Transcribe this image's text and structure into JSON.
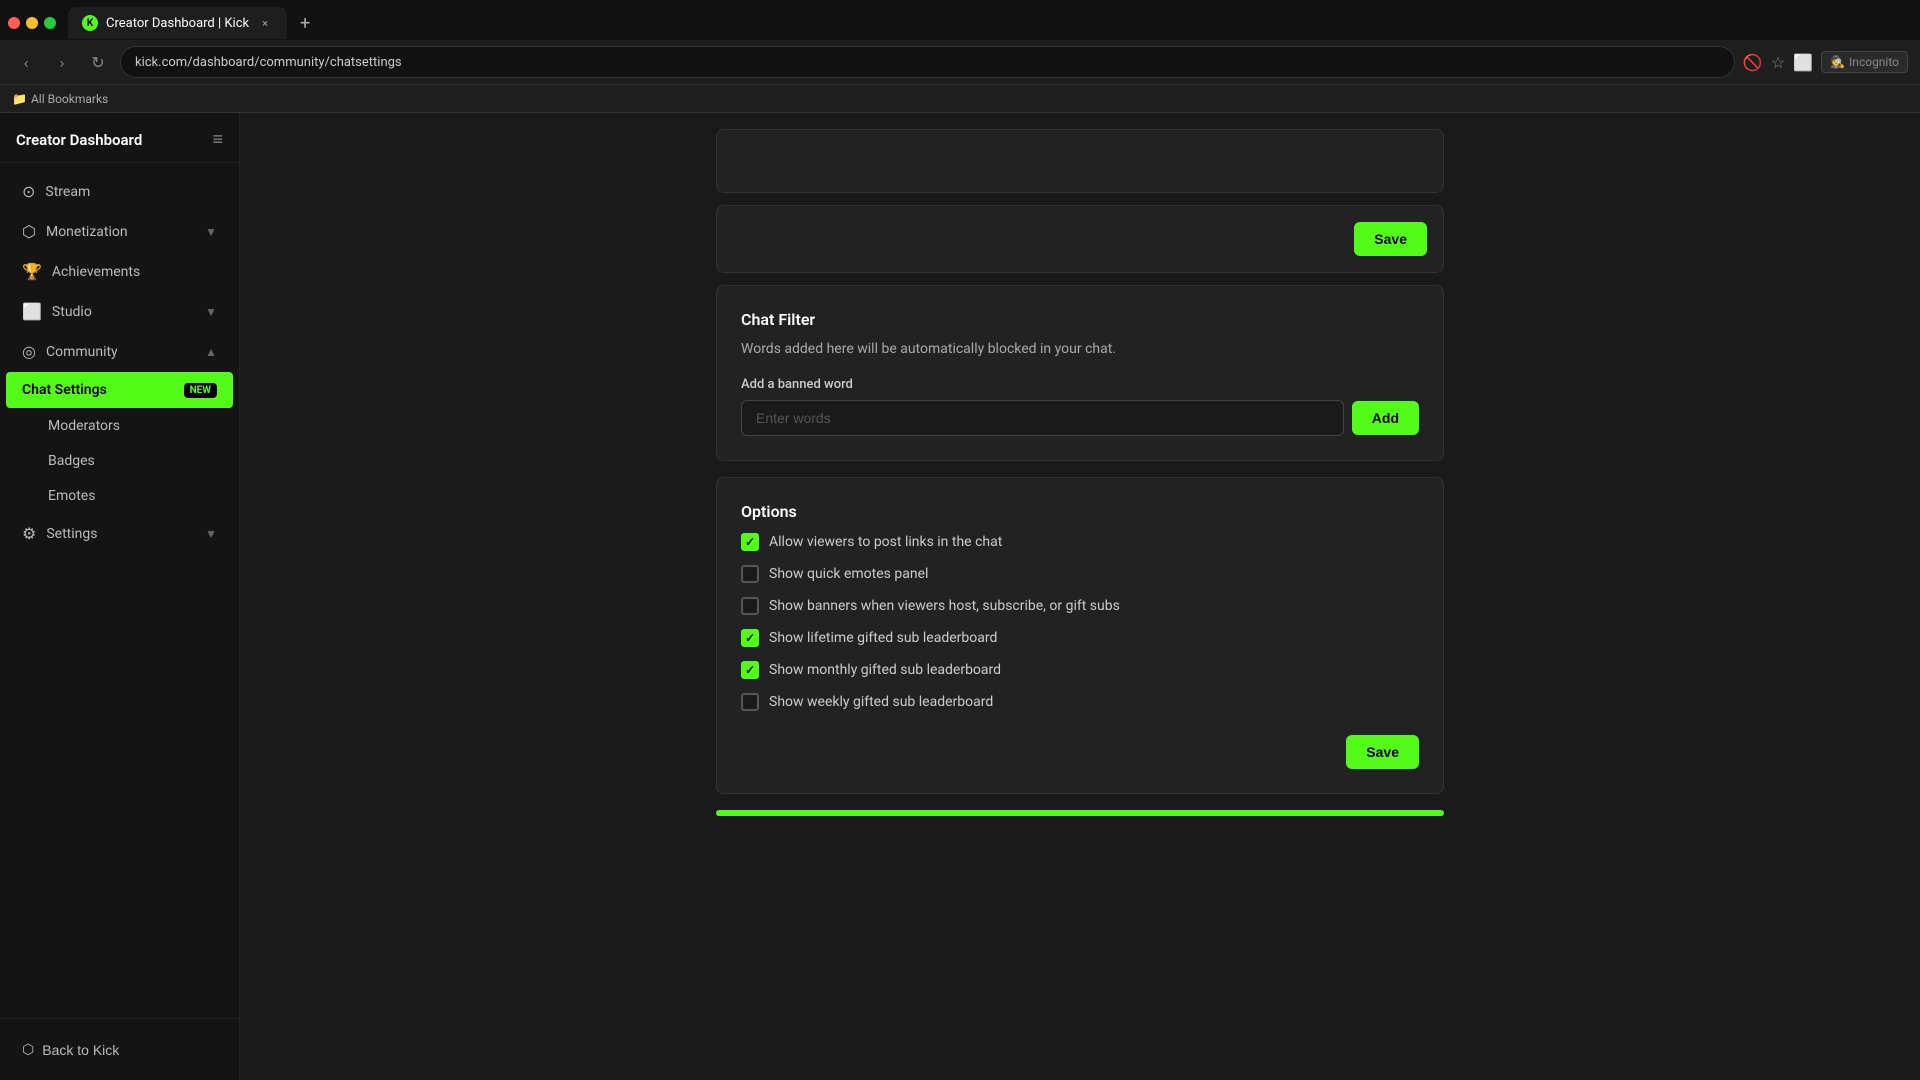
{
  "browser": {
    "tab_title": "Creator Dashboard | Kick",
    "tab_favicon": "K",
    "url": "kick.com/dashboard/community/chatsettings",
    "new_tab_label": "+",
    "close_label": "×",
    "back_label": "‹",
    "forward_label": "›",
    "refresh_label": "↻",
    "incognito_label": "Incognito",
    "bookmarks_label": "All Bookmarks"
  },
  "sidebar": {
    "title": "Creator Dashboard",
    "collapse_icon": "≡",
    "nav_items": [
      {
        "id": "stream",
        "label": "Stream",
        "icon": "⊙",
        "has_arrow": false
      },
      {
        "id": "monetization",
        "label": "Monetization",
        "icon": "⬡",
        "has_arrow": true
      },
      {
        "id": "achievements",
        "label": "Achievements",
        "icon": "🏆",
        "has_arrow": false
      },
      {
        "id": "studio",
        "label": "Studio",
        "icon": "⬜",
        "has_arrow": true
      },
      {
        "id": "community",
        "label": "Community",
        "icon": "◎",
        "has_arrow": true,
        "expanded": true
      }
    ],
    "community_sub_items": [
      {
        "id": "chat-settings",
        "label": "Chat Settings",
        "badge": "NEW",
        "active": true
      },
      {
        "id": "moderators",
        "label": "Moderators"
      },
      {
        "id": "badges",
        "label": "Badges"
      },
      {
        "id": "emotes",
        "label": "Emotes"
      }
    ],
    "settings_item": {
      "label": "Settings",
      "icon": "⚙",
      "has_arrow": true
    },
    "back_btn_label": "Back to Kick",
    "back_btn_icon": "⬡"
  },
  "main": {
    "chat_filter_card": {
      "title": "Chat Filter",
      "description": "Words added here will be automatically blocked in your chat.",
      "banned_word_label": "Add a banned word",
      "banned_word_placeholder": "Enter words",
      "add_button_label": "Add"
    },
    "options_card": {
      "title": "Options",
      "options": [
        {
          "id": "allow-links",
          "label": "Allow viewers to post links in the chat",
          "checked": true
        },
        {
          "id": "quick-emotes",
          "label": "Show quick emotes panel",
          "checked": false
        },
        {
          "id": "banners",
          "label": "Show banners when viewers host, subscribe, or gift subs",
          "checked": false
        },
        {
          "id": "lifetime-gifted",
          "label": "Show lifetime gifted sub leaderboard",
          "checked": true
        },
        {
          "id": "monthly-gifted",
          "label": "Show monthly gifted sub leaderboard",
          "checked": true
        },
        {
          "id": "weekly-gifted",
          "label": "Show weekly gifted sub leaderboard",
          "checked": false
        }
      ],
      "save_button_label": "Save"
    },
    "save_button_label": "Save"
  }
}
